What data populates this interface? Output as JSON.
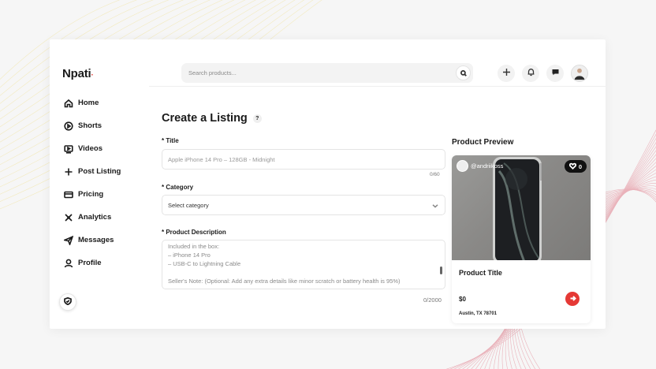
{
  "app": {
    "logo": "Npati",
    "logo_dot": "·"
  },
  "sidebar": {
    "items": [
      {
        "label": "Home",
        "icon": "home-icon"
      },
      {
        "label": "Shorts",
        "icon": "play-circle-icon"
      },
      {
        "label": "Videos",
        "icon": "video-icon"
      },
      {
        "label": "Post Listing",
        "icon": "plus-icon"
      },
      {
        "label": "Pricing",
        "icon": "card-icon"
      },
      {
        "label": "Analytics",
        "icon": "analytics-icon"
      },
      {
        "label": "Messages",
        "icon": "send-icon"
      },
      {
        "label": "Profile",
        "icon": "user-icon"
      }
    ],
    "bottom_icon": "shield-icon"
  },
  "header": {
    "search_placeholder": "Search products...",
    "actions": [
      "plus-icon",
      "bell-icon",
      "chat-icon",
      "avatar"
    ]
  },
  "form": {
    "title": "Create a Listing",
    "help": "?",
    "title_label": "* Title",
    "title_placeholder": "Apple iPhone 14 Pro – 128GB - Midnight",
    "title_counter": "0/60",
    "category_label": "* Category",
    "category_value": "Select category",
    "description_label": "* Product Description",
    "description_lines": [
      "Included in the box:",
      "– iPhone 14 Pro",
      "– USB-C to Lightning Cable",
      "",
      "Seller's Note: (Optional: Add any extra details like minor scratch or battery health is 95%)"
    ],
    "description_counter": "0/2000"
  },
  "preview": {
    "heading": "Product Preview",
    "seller": "@andriikoss",
    "likes": "0",
    "product_title": "Product Title",
    "price": "$0",
    "location": "Austin, TX 78701"
  },
  "colors": {
    "accent": "#e53935",
    "text": "#1a1a1a",
    "muted": "#8a8a8a"
  }
}
